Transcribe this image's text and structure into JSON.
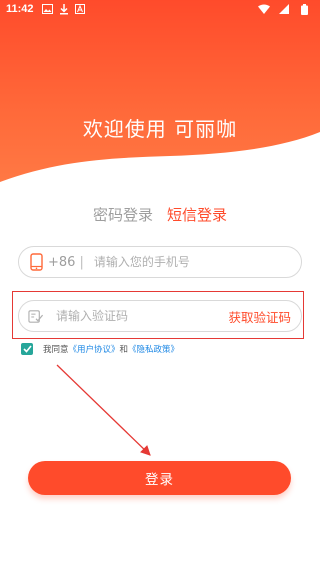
{
  "status_bar": {
    "time": "11:42",
    "icons_left": [
      "image-icon",
      "download-icon",
      "a-icon"
    ],
    "icons_right": [
      "wifi-icon",
      "signal-icon",
      "battery-icon"
    ]
  },
  "hero": {
    "title": "欢迎使用 可丽咖",
    "gradient_top": "#ff4b2b",
    "gradient_bottom": "#ff7a45"
  },
  "tabs": [
    {
      "label": "密码登录",
      "active": false
    },
    {
      "label": "短信登录",
      "active": true
    }
  ],
  "phone_field": {
    "prefix": "+86",
    "separator": "|",
    "placeholder": "请输入您的手机号",
    "icon": "phone-icon"
  },
  "code_field": {
    "placeholder": "请输入验证码",
    "get_code_label": "获取验证码",
    "icon": "edit-icon"
  },
  "agreement": {
    "checked": true,
    "prefix": "我同意",
    "user_agreement": "《用户协议》",
    "and": "和",
    "privacy_policy": "《隐私政策》"
  },
  "login_button": {
    "label": "登录"
  },
  "colors": {
    "accent": "#ff4b2b",
    "checkbox": "#26a69a",
    "link": "#1e88e5",
    "annotation": "#e53935"
  }
}
